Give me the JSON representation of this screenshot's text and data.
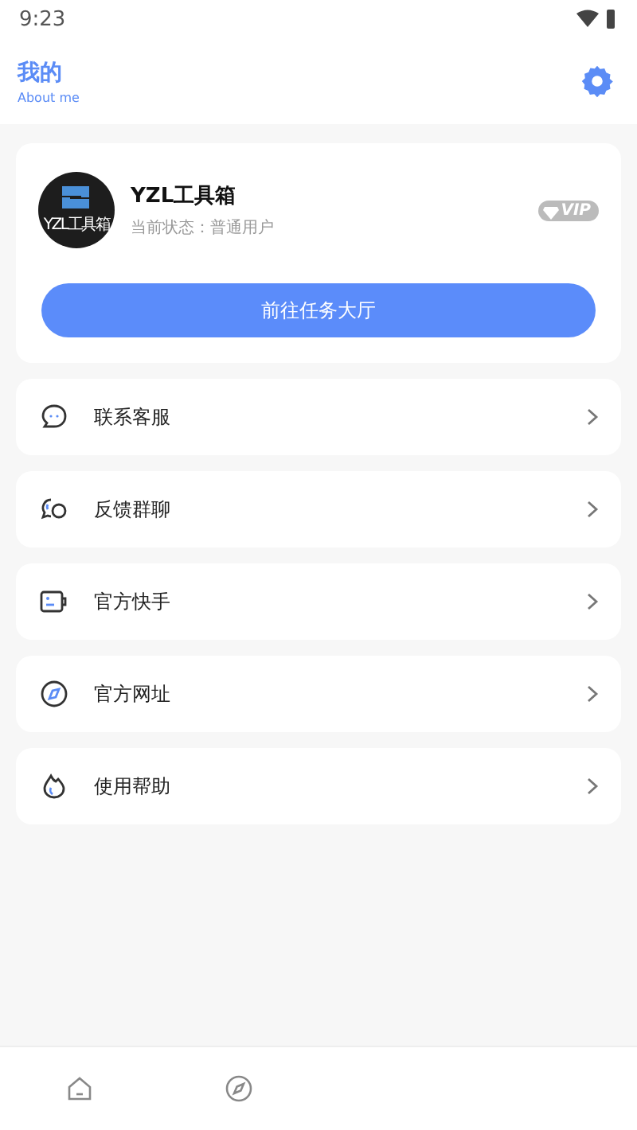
{
  "status_bar": {
    "time": "9:23"
  },
  "header": {
    "title": "我的",
    "subtitle": "About me"
  },
  "profile": {
    "avatar_text": "YZL工具箱",
    "name": "YZL工具箱",
    "status": "当前状态：普通用户",
    "badge": "VIP",
    "button": "前往任务大厅"
  },
  "menu": [
    {
      "kind": "chat",
      "label": "联系客服"
    },
    {
      "kind": "group",
      "label": "反馈群聊"
    },
    {
      "kind": "video",
      "label": "官方快手"
    },
    {
      "kind": "compass",
      "label": "官方网址"
    },
    {
      "kind": "flame",
      "label": "使用帮助"
    }
  ],
  "tab_bar": [
    {
      "kind": "home"
    },
    {
      "kind": "compass"
    }
  ]
}
